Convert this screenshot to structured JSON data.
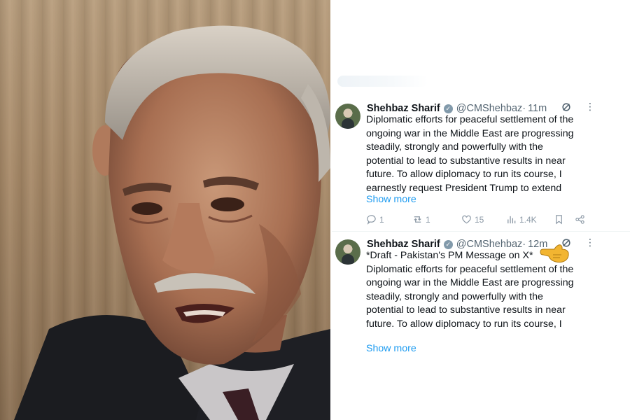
{
  "tweets": [
    {
      "author": "Shehbaz Sharif",
      "handle": "@CMShehbaz",
      "separator": "·",
      "time": "11m",
      "more_icon": "ellipsis-icon",
      "lines": [
        "Diplomatic efforts for peaceful settlement of the",
        "ongoing war in the Middle East are progressing",
        "steadily, strongly and powerfully with the",
        "potential to lead to substantive results in near",
        "future. To allow diplomacy to run its course, I",
        "earnestly request President Trump to extend"
      ],
      "show_more": "Show more",
      "actions": {
        "replies": "1",
        "reposts": "1",
        "likes": "15",
        "views": "1.4K"
      }
    },
    {
      "author": "Shehbaz Sharif",
      "handle": "@CMShehbaz",
      "separator": "·",
      "time": "12m",
      "draft_line": "*Draft - Pakistan's PM Message on X*",
      "lines": [
        "Diplomatic efforts for peaceful settlement of the",
        "ongoing war in the Middle East are progressing",
        "steadily, strongly and powerfully with the",
        "potential to lead to substantive results in near",
        "future. To allow diplomacy to run its course, I"
      ],
      "show_more": "Show more"
    }
  ],
  "colors": {
    "link": "#1d9bf0",
    "muted": "#536471",
    "text": "#0f1419",
    "badge": "#829aab",
    "pointer": "#f2b531"
  }
}
